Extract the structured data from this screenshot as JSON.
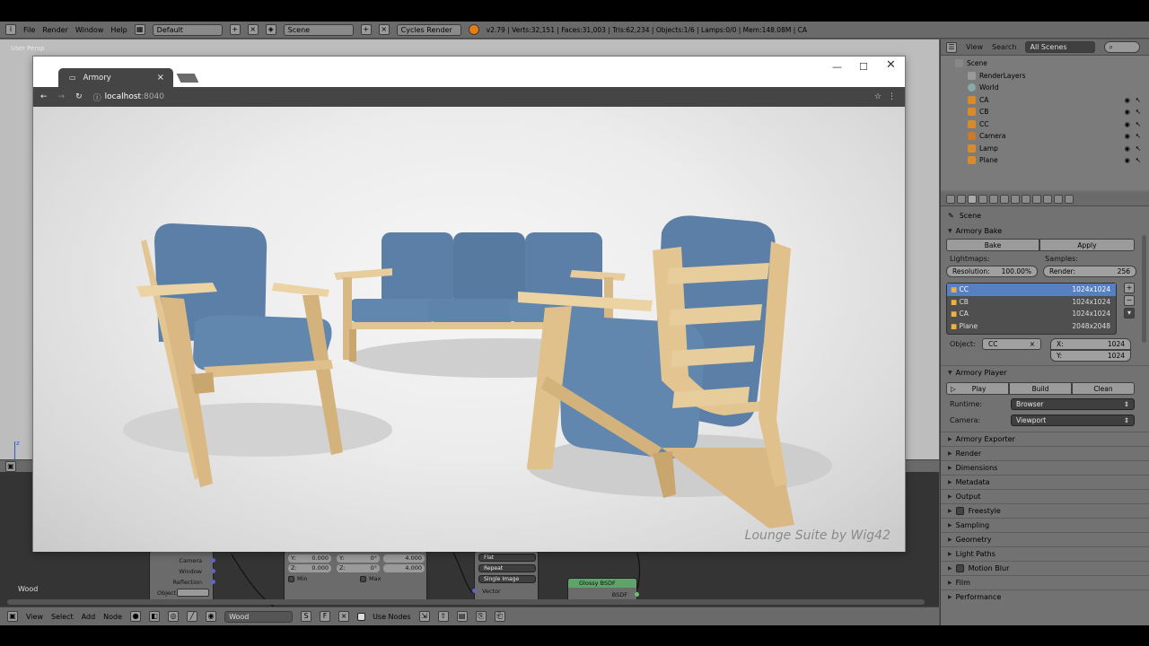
{
  "blender": {
    "menu": [
      "File",
      "Render",
      "Window",
      "Help"
    ],
    "layout": "Default",
    "scene": "Scene",
    "engine": "Cycles Render",
    "stats": "v2.79 | Verts:32,151 | Faces:31,003 | Tris:62,234 | Objects:1/6 | Lamps:0/0 | Mem:148.08M | CA",
    "viewport_label": "User Persp",
    "axis_z": "z",
    "outliner": {
      "view": "View",
      "search": "Search",
      "filter": "All Scenes",
      "items": [
        {
          "name": "Scene",
          "indent": 0
        },
        {
          "name": "RenderLayers",
          "indent": 1
        },
        {
          "name": "World",
          "indent": 1
        },
        {
          "name": "CA",
          "indent": 1
        },
        {
          "name": "CB",
          "indent": 1
        },
        {
          "name": "CC",
          "indent": 1
        },
        {
          "name": "Camera",
          "indent": 1
        },
        {
          "name": "Lamp",
          "indent": 1
        },
        {
          "name": "Plane",
          "indent": 1
        }
      ]
    },
    "props": {
      "context": "Scene",
      "bake": {
        "title": "Armory Bake",
        "bake_btn": "Bake",
        "apply_btn": "Apply",
        "lightmaps": "Lightmaps:",
        "samples": "Samples:",
        "resolution_label": "Resolution:",
        "resolution_value": "100.00%",
        "render_label": "Render:",
        "render_value": "256",
        "list": [
          {
            "name": "CC",
            "size": "1024x1024"
          },
          {
            "name": "CB",
            "size": "1024x1024"
          },
          {
            "name": "CA",
            "size": "1024x1024"
          },
          {
            "name": "Plane",
            "size": "2048x2048"
          }
        ],
        "object_label": "Object:",
        "object_value": "CC",
        "x_label": "X:",
        "x_value": "1024",
        "y_label": "Y:",
        "y_value": "1024"
      },
      "player": {
        "title": "Armory Player",
        "play": "Play",
        "build": "Build",
        "clean": "Clean",
        "runtime_label": "Runtime:",
        "runtime_value": "Browser",
        "camera_label": "Camera:",
        "camera_value": "Viewport"
      },
      "panels": [
        "Armory Exporter",
        "Render",
        "Dimensions",
        "Metadata",
        "Output",
        "Freestyle",
        "Sampling",
        "Geometry",
        "Light Paths",
        "Motion Blur",
        "Film",
        "Performance"
      ]
    },
    "nodes": {
      "material_name": "Wood",
      "left_node": {
        "rows": [
          "Camera",
          "Window",
          "Reflection"
        ],
        "object_label": "Object"
      },
      "vec_node": {
        "y": "Y:",
        "z": "Z:",
        "y_val": "0.000",
        "z_val": "0.000",
        "min": "Min"
      },
      "rot_node": {
        "y": "Y:",
        "z": "Z:",
        "y_val": "0°",
        "z_val": "0°",
        "max": "Max"
      },
      "scale_node": {
        "y_val": "4.000",
        "z_val": "4.000"
      },
      "tex_node": {
        "opts": [
          "Flat",
          "Repeat",
          "Single Image"
        ],
        "vector": "Vector"
      },
      "glossy": {
        "title": "Glossy BSDF",
        "out": "BSDF"
      }
    },
    "node_footer": {
      "menu": [
        "View",
        "Select",
        "Add",
        "Node"
      ],
      "material": "Wood",
      "f_btn": "F",
      "s_btn": "S",
      "use_nodes": "Use Nodes"
    }
  },
  "browser": {
    "tab_title": "Armory",
    "url_host": "localhost",
    "url_port": ":8040",
    "watermark": "Lounge Suite by Wig42"
  },
  "colors": {
    "fabric": "#5b7fa6",
    "fabric_dark": "#46698f",
    "wood": "#e3c592",
    "wood_dark": "#c9a66e",
    "selection": "#5680c2"
  }
}
